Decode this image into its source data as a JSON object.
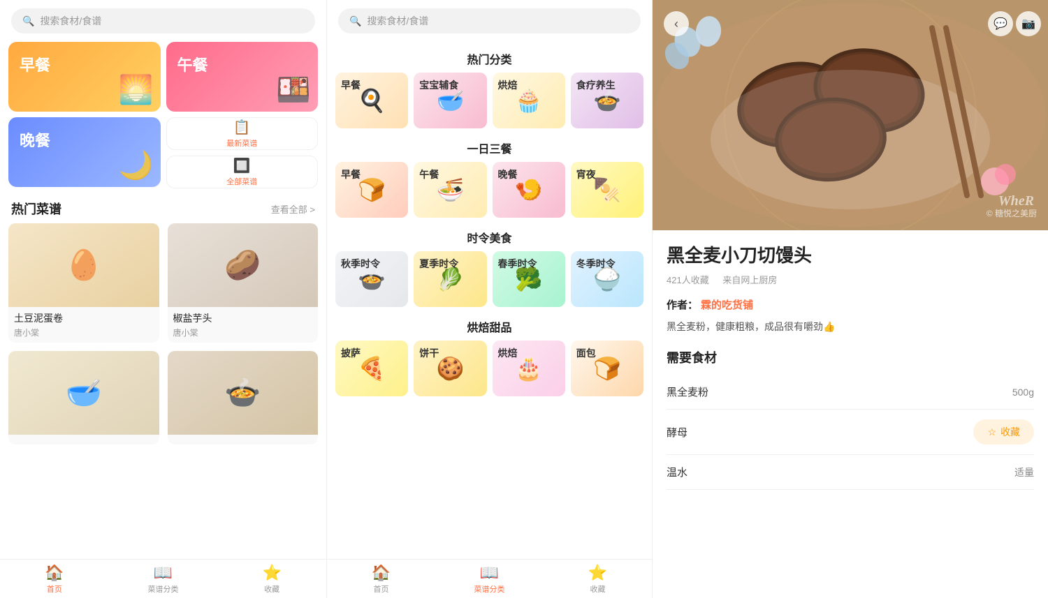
{
  "left": {
    "search_placeholder": "搜索食材/食谱",
    "meals": [
      {
        "id": "breakfast",
        "label": "早餐",
        "icon": "🌅",
        "class": "breakfast-card"
      },
      {
        "id": "lunch",
        "label": "午餐",
        "icon": "🍱",
        "class": "lunch-card"
      },
      {
        "id": "dinner",
        "label": "晚餐",
        "icon": "🌙",
        "class": "dinner-card"
      }
    ],
    "small_cards": [
      {
        "id": "new-recipes",
        "icon": "📋",
        "label": "最新菜谱"
      },
      {
        "id": "all-recipes",
        "icon": "🔲",
        "label": "全部菜谱"
      }
    ],
    "popular_section": {
      "title": "热门菜谱",
      "see_all": "查看全部 >"
    },
    "recipes": [
      {
        "id": "r1",
        "name": "土豆泥蛋卷",
        "author": "唐小棠",
        "emoji": "🥚"
      },
      {
        "id": "r2",
        "name": "椒盐芋头",
        "author": "唐小棠",
        "emoji": "🥔"
      },
      {
        "id": "r3",
        "name": "",
        "author": "",
        "emoji": "🥣"
      },
      {
        "id": "r4",
        "name": "",
        "author": "",
        "emoji": "🍲"
      }
    ],
    "nav": [
      {
        "id": "home",
        "icon": "🏠",
        "label": "首页",
        "active": true
      },
      {
        "id": "category",
        "icon": "📖",
        "label": "菜谱分类",
        "active": false
      },
      {
        "id": "favorites",
        "icon": "⭐",
        "label": "收藏",
        "active": false
      }
    ]
  },
  "middle": {
    "search_placeholder": "搜索食材/食谱",
    "sections": [
      {
        "id": "hot-categories",
        "title": "热门分类",
        "items": [
          {
            "id": "zaocan",
            "label": "早餐",
            "class": "img-breakfast",
            "emoji": "🍳"
          },
          {
            "id": "baobao",
            "label": "宝宝辅食",
            "class": "img-baby",
            "emoji": "🥣"
          },
          {
            "id": "hongbei",
            "label": "烘焙",
            "class": "img-baking",
            "emoji": "🧁"
          },
          {
            "id": "food-therapy",
            "label": "食疗养生",
            "class": "img-health",
            "emoji": "🍲"
          }
        ]
      },
      {
        "id": "three-meals",
        "title": "一日三餐",
        "items": [
          {
            "id": "zaocan2",
            "label": "早餐",
            "class": "img-b",
            "emoji": "🍞"
          },
          {
            "id": "wucan",
            "label": "午餐",
            "class": "img-l",
            "emoji": "🍜"
          },
          {
            "id": "wancan",
            "label": "晚餐",
            "class": "img-d",
            "emoji": "🍤"
          },
          {
            "id": "xiaoye",
            "label": "宵夜",
            "class": "img-n",
            "emoji": "🍢"
          }
        ]
      },
      {
        "id": "seasonal",
        "title": "时令美食",
        "items": [
          {
            "id": "autumn",
            "label": "秋季时令",
            "class": "img-autumn",
            "emoji": "🍲"
          },
          {
            "id": "summer",
            "label": "夏季时令",
            "class": "img-summer",
            "emoji": "🥬"
          },
          {
            "id": "spring",
            "label": "春季时令",
            "class": "img-spring",
            "emoji": "🥦"
          },
          {
            "id": "winter",
            "label": "冬季时令",
            "class": "img-winter",
            "emoji": "🍚"
          }
        ]
      },
      {
        "id": "baking-dessert",
        "title": "烘焙甜品",
        "items": [
          {
            "id": "pizza",
            "label": "披萨",
            "class": "img-pizza",
            "emoji": "🍕"
          },
          {
            "id": "cookie",
            "label": "饼干",
            "class": "img-cookie",
            "emoji": "🍪"
          },
          {
            "id": "cake",
            "label": "烘焙",
            "class": "img-cake",
            "emoji": "🎂"
          },
          {
            "id": "bread",
            "label": "面包",
            "class": "img-bread",
            "emoji": "🍞"
          }
        ]
      }
    ],
    "nav": [
      {
        "id": "home",
        "icon": "🏠",
        "label": "首页",
        "active": false
      },
      {
        "id": "category",
        "icon": "📖",
        "label": "菜谱分类",
        "active": true
      },
      {
        "id": "favorites",
        "icon": "⭐",
        "label": "收藏",
        "active": false
      }
    ]
  },
  "right": {
    "back_icon": "‹",
    "wechat_icon": "💬",
    "share_icon": "📷",
    "watermark": "© 糖悦之美厨",
    "wher_text": "WheR",
    "title": "黑全麦小刀切馒头",
    "meta": {
      "favorites_count": "421人收藏",
      "source": "来自网上厨房"
    },
    "author_label": "作者：",
    "author_name": "霖的吃货铺",
    "description": "黑全麦粉，健康粗粮，成品很有嚼劲👍",
    "ingredients_title": "需要食材",
    "ingredients": [
      {
        "name": "黑全麦粉",
        "amount": "500g"
      },
      {
        "name": "酵母",
        "amount": "",
        "has_collect": true
      },
      {
        "name": "温水",
        "amount": "适量"
      }
    ],
    "collect_btn": "收藏"
  }
}
